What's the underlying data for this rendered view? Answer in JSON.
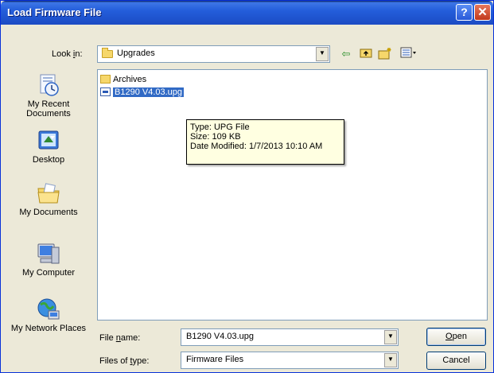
{
  "window": {
    "title": "Load Firmware File",
    "help_glyph": "?",
    "close_glyph": "✕"
  },
  "lookin": {
    "label_pre": "Look ",
    "label_ul": "i",
    "label_post": "n:",
    "value": "Upgrades"
  },
  "toolbar": {
    "back_glyph": "⇦",
    "up_glyph": "⬑",
    "new_folder_glyph": "✳",
    "view_glyph": "▦▾"
  },
  "places": [
    {
      "label": "My Recent Documents",
      "icon": "recent-documents-icon"
    },
    {
      "label": "Desktop",
      "icon": "desktop-icon"
    },
    {
      "label": "My Documents",
      "icon": "my-documents-icon"
    },
    {
      "label": "My Computer",
      "icon": "my-computer-icon"
    },
    {
      "label": "My Network Places",
      "icon": "network-places-icon"
    }
  ],
  "files": [
    {
      "name": "Archives",
      "type": "folder"
    },
    {
      "name": "B1290 V4.03.upg",
      "type": "file",
      "selected": true
    }
  ],
  "tooltip": {
    "line1": "Type: UPG File",
    "line2": "Size: 109 KB",
    "line3": "Date Modified: 1/7/2013 10:10 AM"
  },
  "filename": {
    "label_pre": "File ",
    "label_ul": "n",
    "label_post": "ame:",
    "value": "B1290 V4.03.upg"
  },
  "filetype": {
    "label_pre": "Files of ",
    "label_ul": "t",
    "label_post": "ype:",
    "value": "Firmware Files"
  },
  "buttons": {
    "open_ul": "O",
    "open_post": "pen",
    "cancel": "Cancel"
  },
  "colors": {
    "titlebar": "#245edb",
    "selection": "#316ac5",
    "tooltip_bg": "#ffffe1",
    "face": "#ece9d8"
  }
}
